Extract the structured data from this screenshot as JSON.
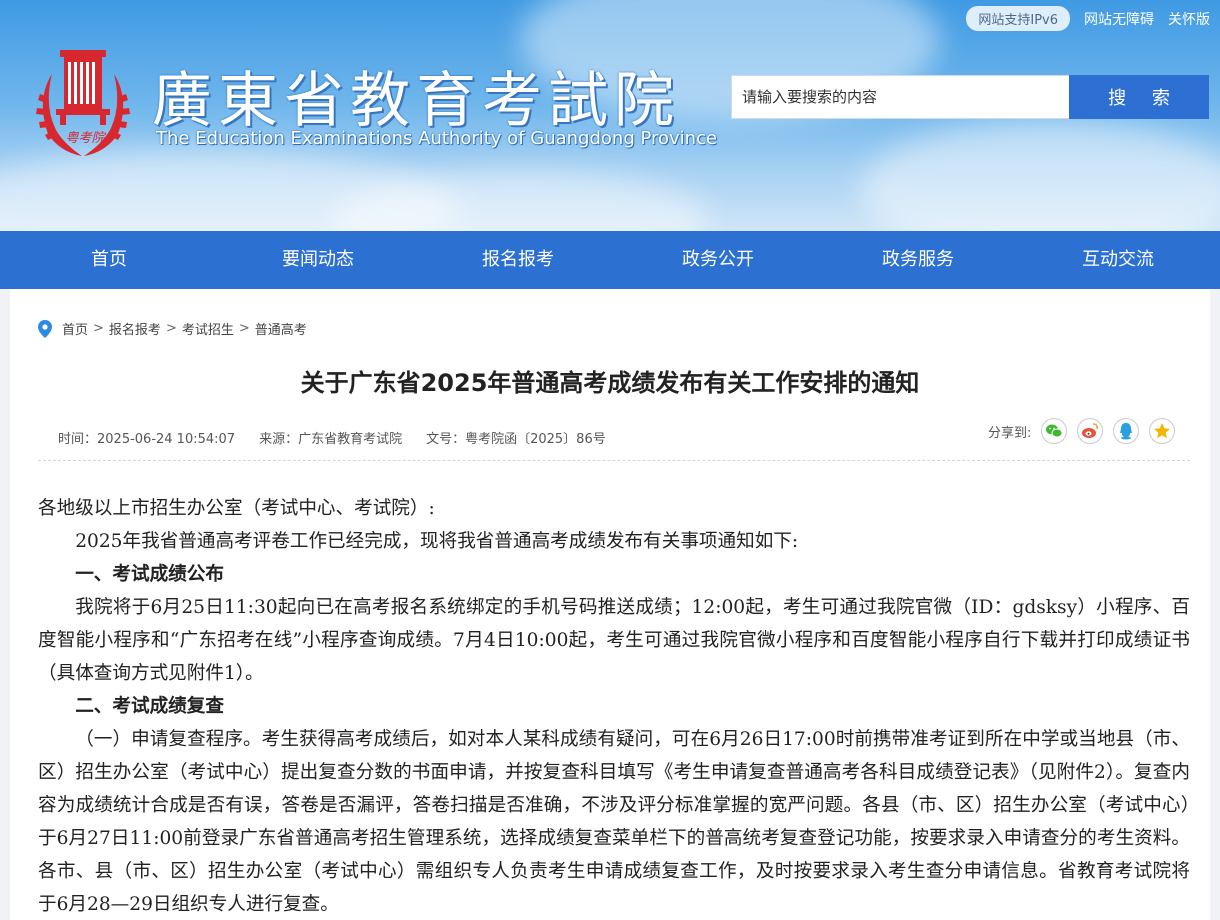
{
  "topbar": {
    "ipv6": "网站支持IPv6",
    "accessibility": "网站无障碍",
    "care_mode": "关怀版"
  },
  "logo": {
    "name_cn": "廣東省教育考試院",
    "name_en": "The Education Examinations Authority of Guangdong Province",
    "seal_text": "粤考院"
  },
  "search": {
    "placeholder": "请输入要搜索的内容",
    "button": "搜 索"
  },
  "nav": [
    "首页",
    "要闻动态",
    "报名报考",
    "政务公开",
    "政务服务",
    "互动交流"
  ],
  "breadcrumb": [
    "首页",
    "报名报考",
    "考试招生",
    "普通高考"
  ],
  "breadcrumb_sep": ">",
  "article": {
    "title": "关于广东省2025年普通高考成绩发布有关工作安排的通知",
    "time": "时间：2025-06-24 10:54:07",
    "source": "来源：广东省教育考试院",
    "doc_no": "文号：粤考院函〔2025〕86号",
    "share_label": "分享到:",
    "share_icons": [
      "wechat-icon",
      "weibo-icon",
      "qq-icon",
      "qzone-icon"
    ],
    "salutation": "各地级以上市招生办公室（考试中心、考试院）:",
    "intro": "2025年我省普通高考评卷工作已经完成，现将我省普通高考成绩发布有关事项通知如下:",
    "section1": "一、考试成绩公布",
    "para1": "我院将于6月25日11:30起向已在高考报名系统绑定的手机号码推送成绩；12:00起，考生可通过我院官微（ID：gdsksy）小程序、百度智能小程序和“广东招考在线”小程序查询成绩。7月4日10:00起，考生可通过我院官微小程序和百度智能小程序自行下载并打印成绩证书（具体查询方式见附件1）。",
    "section2": "二、考试成绩复查",
    "para2": "（一）申请复查程序。考生获得高考成绩后，如对本人某科成绩有疑问，可在6月26日17:00时前携带准考证到所在中学或当地县（市、区）招生办公室（考试中心）提出复查分数的书面申请，并按复查科目填写《考生申请复查普通高考各科目成绩登记表》（见附件2）。复查内容为成绩统计合成是否有误，答卷是否漏评，答卷扫描是否准确，不涉及评分标准掌握的宽严问题。各县（市、区）招生办公室（考试中心）于6月27日11:00前登录广东省普通高考招生管理系统，选择成绩复查菜单栏下的普高统考复查登记功能，按要求录入申请查分的考生资料。各市、县（市、区）招生办公室（考试中心）需组织专人负责考生申请成绩复查工作，及时按要求录入考生查分申请信息。省教育考试院将于6月28—29日组织专人进行复查。"
  },
  "colors": {
    "nav": "#2c70d2",
    "search_button": "#2d6fd3",
    "seal_red": "#d8282f"
  }
}
